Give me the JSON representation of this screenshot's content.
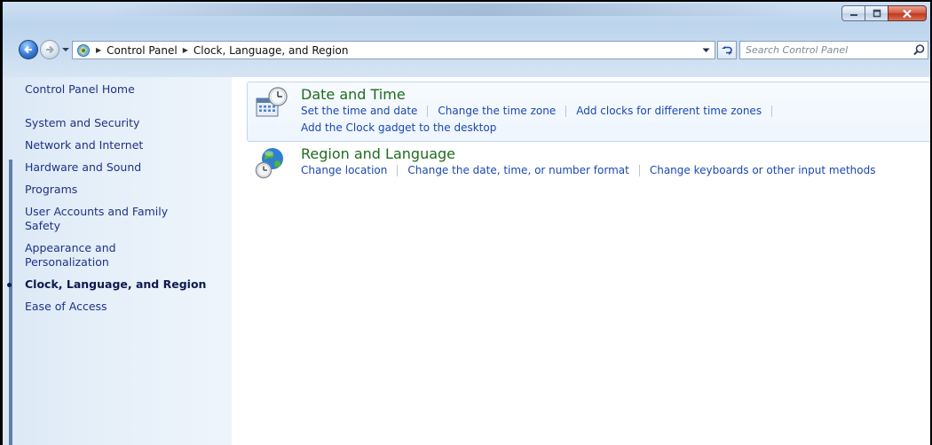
{
  "window": {
    "colors": {
      "accent": "#1e6c1e",
      "link": "#1b47b3",
      "nav_link": "#1e3287",
      "close_red": "#c2391e"
    },
    "controls": [
      {
        "name": "minimize",
        "icon": "minimize-icon"
      },
      {
        "name": "maximize",
        "icon": "maximize-icon"
      },
      {
        "name": "close",
        "icon": "close-icon"
      }
    ]
  },
  "address": {
    "icon": "control-panel-icon",
    "crumbs": [
      "Control Panel",
      "Clock, Language, and Region"
    ]
  },
  "search": {
    "placeholder": "Search Control Panel",
    "value": ""
  },
  "left_nav": {
    "home": "Control Panel Home",
    "items": [
      {
        "label": "System and Security"
      },
      {
        "label": "Network and Internet"
      },
      {
        "label": "Hardware and Sound"
      },
      {
        "label": "Programs"
      },
      {
        "label": "User Accounts and Family\nSafety"
      },
      {
        "label": "Appearance and\nPersonalization"
      },
      {
        "label": "Clock, Language, and Region",
        "current": true
      },
      {
        "label": "Ease of Access"
      }
    ]
  },
  "categories": [
    {
      "title": "Date and Time",
      "icon": "clock-calendar-icon",
      "tasks": [
        [
          "Set the time and date",
          "Change the time zone",
          "Add clocks for different time zones"
        ],
        [
          "Add the Clock gadget to the desktop"
        ]
      ]
    },
    {
      "title": "Region and Language",
      "icon": "globe-clock-icon",
      "tasks": [
        [
          "Change location",
          "Change the date, time, or number format",
          "Change keyboards or other input methods"
        ]
      ]
    }
  ]
}
